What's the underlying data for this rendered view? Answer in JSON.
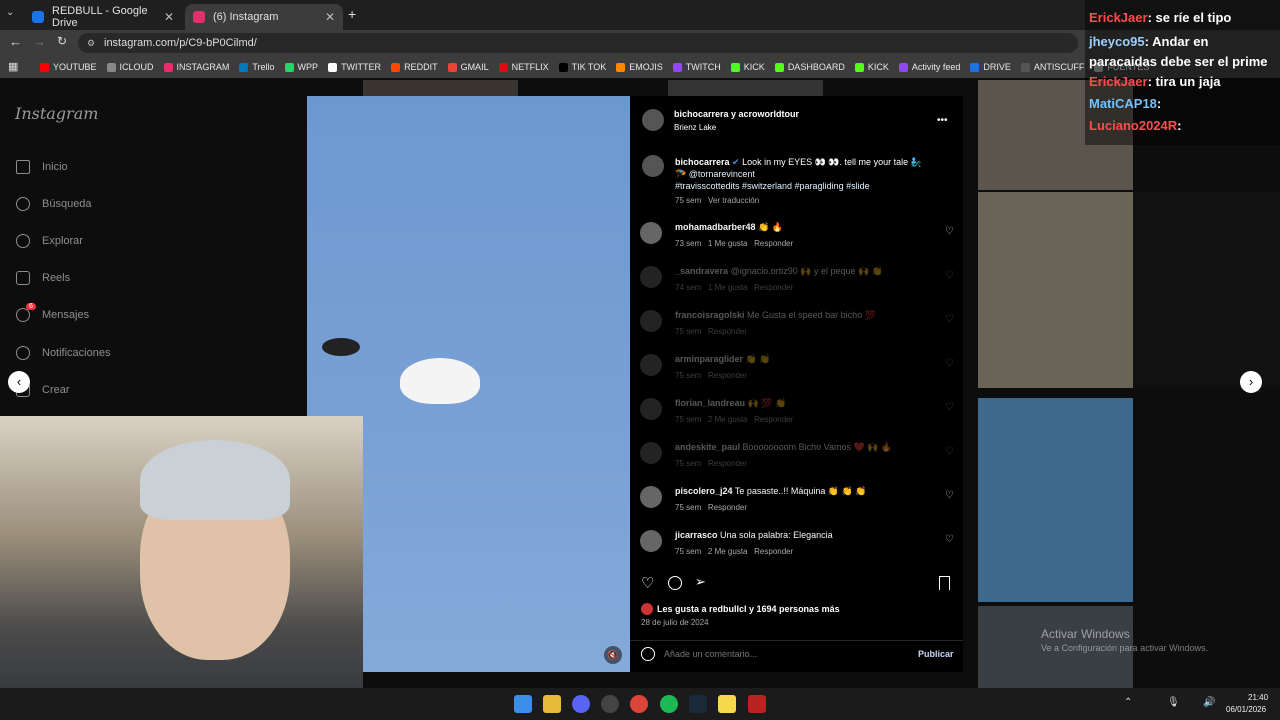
{
  "browser": {
    "tabs": [
      {
        "title": "REDBULL - Google Drive",
        "favicon_color": "#1a73e8"
      },
      {
        "title": "(6) Instagram",
        "favicon_color": "#e1306c"
      }
    ],
    "new_tab": "+",
    "url": "instagram.com/p/C9-bP0Cilmd/",
    "bookmarks": [
      "YOUTUBE",
      "ICLOUD",
      "INSTAGRAM",
      "Trello",
      "WPP",
      "TWITTER",
      "REDDIT",
      "GMAIL",
      "NETFLIX",
      "TIK TOK",
      "EMOJIS",
      "TWITCH",
      "KICK",
      "DASHBOARD",
      "KICK",
      "Activity feed",
      "DRIVE",
      "ANTISCUFF",
      "FUENTES"
    ]
  },
  "sidebar": {
    "logo": "Instagram",
    "items": [
      {
        "label": "Inicio",
        "icon": "home-icon"
      },
      {
        "label": "Búsqueda",
        "icon": "search-icon"
      },
      {
        "label": "Explorar",
        "icon": "compass-icon"
      },
      {
        "label": "Reels",
        "icon": "reels-icon"
      },
      {
        "label": "Mensajes",
        "icon": "messenger-icon",
        "badge": "6"
      },
      {
        "label": "Notificaciones",
        "icon": "heart-icon"
      },
      {
        "label": "Crear",
        "icon": "plus-icon"
      }
    ]
  },
  "post": {
    "header_users": "bichocarrera y acroworldtour",
    "location": "Brienz Lake",
    "more": "•••",
    "caption_user": "bichocarrera",
    "caption_text": "Look in my EYES 👀 👀. tell me your tale 🧞‍♂️ 🪂",
    "caption_mention": "@tornarevincent",
    "caption_tags": "#travisscottedits #switzerland #paragliding #slide",
    "caption_time": "75 sem",
    "translate": "Ver traducción",
    "comments": [
      {
        "user": "mohamadbarber48",
        "text": "👏 🔥",
        "time": "73 sem",
        "likes": "1 Me gusta",
        "reply": "Responder"
      },
      {
        "user": "_sandravera",
        "text": "@ignacio.ortiz90 🙌 y el peque 🙌 👏",
        "time": "74 sem",
        "likes": "1 Me gusta",
        "reply": "Responder"
      },
      {
        "user": "francoisragolski",
        "text": "Me Gusta el speed bar bicho 💯",
        "time": "75 sem",
        "likes": "",
        "reply": "Responder"
      },
      {
        "user": "arminparaglider",
        "text": "👏 👏",
        "time": "75 sem",
        "likes": "",
        "reply": "Responder"
      },
      {
        "user": "florian_landreau",
        "text": "🙌 💯 👏",
        "time": "75 sem",
        "likes": "2 Me gusta",
        "reply": "Responder"
      },
      {
        "user": "andeskite_paul",
        "text": "Boooooooom Bicho Vamos ❤️ 🙌 🔥",
        "time": "75 sem",
        "likes": "",
        "reply": "Responder"
      },
      {
        "user": "piscolero_j24",
        "text": "Te pasaste..!! Máquina 👏 👏 👏",
        "time": "75 sem",
        "likes": "",
        "reply": "Responder"
      },
      {
        "user": "jicarrasco",
        "text": "Una sola palabra: Elegancia",
        "time": "75 sem",
        "likes": "2 Me gusta",
        "reply": "Responder"
      }
    ],
    "likes_line": "Les gusta a redbullcl y 1694 personas más",
    "date": "28 de julio de 2024",
    "comment_placeholder": "Añade un comentario...",
    "publish": "Publicar"
  },
  "overlay": {
    "windows_activate_title": "Activar Windows",
    "windows_activate_sub": "Ve a Configuración para activar Windows.",
    "clock_time": "21:40",
    "clock_date": "06/01/2026"
  },
  "chat": [
    {
      "user": "ErickJaer",
      "text": "se ríe el tipo",
      "color": "#ff4d4d"
    },
    {
      "user": "jheyco95",
      "text": "Andar en paracaidas debe ser el prime",
      "color": "#9ad0ff"
    },
    {
      "user": "ErickJaer",
      "text": "tira un jaja",
      "color": "#ff4d4d"
    },
    {
      "user": "MatiCAP18",
      "text": "",
      "color": "#6fc3ff"
    },
    {
      "user": "Luciano2024R",
      "text": "",
      "color": "#ff4d4d"
    }
  ]
}
